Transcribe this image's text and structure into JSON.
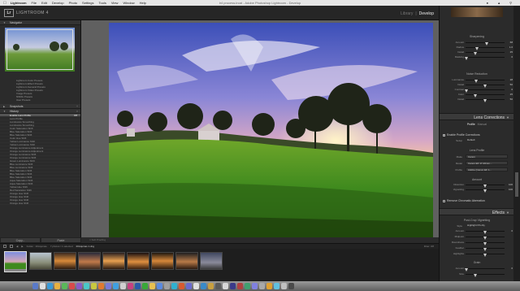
{
  "menubar": {
    "app": "Lightroom",
    "items": [
      "File",
      "Edit",
      "Develop",
      "Photo",
      "Settings",
      "Tools",
      "View",
      "Window",
      "Help"
    ],
    "window_title": "lr4 process.lrcat - Adobe Photoshop Lightroom - Develop"
  },
  "header": {
    "logo": "Lr",
    "app_name": "LIGHTROOM 4",
    "modules": [
      "Library",
      "Develop"
    ],
    "module_separator": "|",
    "active_module": "Develop"
  },
  "left_panel": {
    "navigator_label": "Navigator",
    "presets": [
      "Lightroom Color Presets",
      "Lightroom Effect Presets",
      "Lightroom General Presets",
      "Lightroom Video Presets",
      "Image Presets",
      "NSMG Presets",
      "User Presets"
    ],
    "snapshots_label": "Snapshots",
    "history_label": "History",
    "history_items": [
      {
        "label": "Enable Lens Profile",
        "value": "Off",
        "selected": true
      },
      {
        "label": "Lens Profile",
        "value": ""
      },
      {
        "label": "Luminance Smoothing",
        "value": ""
      },
      {
        "label": "Luminance Smoothing",
        "value": ""
      },
      {
        "label": "Color Saturation Shift",
        "value": ""
      },
      {
        "label": "Blue Saturation Shift",
        "value": ""
      },
      {
        "label": "Blue Saturation Shift",
        "value": ""
      },
      {
        "label": "Color Hue Shift",
        "value": ""
      },
      {
        "label": "Yellow Luminance Shift",
        "value": ""
      },
      {
        "label": "Yellow Luminance Shift",
        "value": ""
      },
      {
        "label": "Orange Luminance Adjustment",
        "value": ""
      },
      {
        "label": "Orange Luminance Adjustment",
        "value": ""
      },
      {
        "label": "Orange Luminance Shift",
        "value": ""
      },
      {
        "label": "Orange Luminance Shift",
        "value": ""
      },
      {
        "label": "Green Luminance Shift",
        "value": ""
      },
      {
        "label": "Blue Luminance Shift",
        "value": ""
      },
      {
        "label": "Blue Luminance Shift",
        "value": ""
      },
      {
        "label": "Blue Saturation Shift",
        "value": ""
      },
      {
        "label": "Blue Saturation Shift",
        "value": ""
      },
      {
        "label": "Blue Saturation Shift",
        "value": ""
      },
      {
        "label": "Aqua Saturation Shift",
        "value": ""
      },
      {
        "label": "Aqua Saturation Shift",
        "value": ""
      },
      {
        "label": "Yellow Hue Shift",
        "value": ""
      },
      {
        "label": "Red Saturation Shift",
        "value": ""
      },
      {
        "label": "Orange Hue Shift",
        "value": ""
      },
      {
        "label": "Orange Hue Shift",
        "value": ""
      },
      {
        "label": "Orange Hue Shift",
        "value": ""
      },
      {
        "label": "Orange Hue Shift",
        "value": ""
      }
    ],
    "copy_button": "Copy...",
    "paste_button": "Paste"
  },
  "toolbar": {
    "text": "Soft Proofing"
  },
  "filmbar": {
    "path": "Folder : 20Aquinas",
    "count": "7 photos / 1 selected",
    "filename": "20Aquinas 1.dng",
    "filter_label": "Filter:",
    "filter_value": "Off"
  },
  "right_panel": {
    "sharpening_label": "Sharpening",
    "sharpening": [
      {
        "label": "Amount",
        "value": "68",
        "pos": 0.55
      },
      {
        "label": "Radius",
        "value": "1.0",
        "pos": 0.3
      },
      {
        "label": "Detail",
        "value": "25",
        "pos": 0.25
      },
      {
        "label": "Masking",
        "value": "0",
        "pos": 0.02
      }
    ],
    "noise_label": "Noise Reduction",
    "noise": [
      {
        "label": "Luminance",
        "value": "28",
        "pos": 0.28
      },
      {
        "label": "Detail",
        "value": "50",
        "pos": 0.5
      },
      {
        "label": "Contrast",
        "value": "0",
        "pos": 0.02
      },
      {
        "label": "Color",
        "value": "25",
        "pos": 0.25
      },
      {
        "label": "Detail",
        "value": "50",
        "pos": 0.5
      }
    ],
    "lens_header": "Lens Corrections",
    "lens_tabs": [
      "Profile",
      "Manual"
    ],
    "active_lens_tab": "Profile",
    "enable_profile": "Enable Profile Corrections",
    "setup_label": "Setup",
    "setup_value": "Default",
    "lens_profile_label": "Lens Profile",
    "lens_profile": [
      {
        "label": "Make",
        "value": "Canon"
      },
      {
        "label": "Model",
        "value": "Canon EF 17-40mm..."
      },
      {
        "label": "Profile",
        "value": "Adobe (Canon EF 1..."
      }
    ],
    "amount_label": "Amount",
    "amount": [
      {
        "label": "Distortion",
        "value": "100",
        "pos": 0.5
      },
      {
        "label": "Vignetting",
        "value": "100",
        "pos": 0.5
      }
    ],
    "remove_ca": "Remove Chromatic Aberration",
    "effects_header": "Effects",
    "vignetting_label": "Post-Crop Vignetting",
    "style_label": "Style",
    "style_value": "Highlight Priority",
    "vignette": [
      {
        "label": "Amount",
        "value": "0",
        "pos": 0.5
      },
      {
        "label": "Midpoint",
        "value": "",
        "pos": 0.5
      },
      {
        "label": "Roundness",
        "value": "",
        "pos": 0.5
      },
      {
        "label": "Feather",
        "value": "",
        "pos": 0.5
      },
      {
        "label": "Highlights",
        "value": "",
        "pos": 0.5
      }
    ],
    "grain_label": "Grain",
    "grain": [
      {
        "label": "Amount",
        "value": "0",
        "pos": 0.02
      },
      {
        "label": "Size",
        "value": "",
        "pos": 0.25
      }
    ]
  },
  "colors": {
    "panel_bg": "#2b2b2b",
    "header_bg": "#262626",
    "selected": "#555555"
  }
}
